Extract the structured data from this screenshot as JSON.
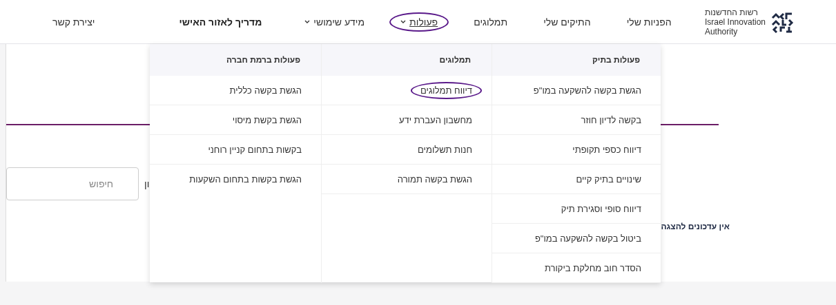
{
  "logo": {
    "lines": [
      "רשות החדשנות",
      "Israel Innovation",
      "Authority"
    ]
  },
  "nav": [
    {
      "label": "הפניות שלי",
      "kind": "link",
      "active": false,
      "circled": false
    },
    {
      "label": "התיקים שלי",
      "kind": "link",
      "active": false,
      "circled": false
    },
    {
      "label": "תמלוגים",
      "kind": "link",
      "active": false,
      "circled": false
    },
    {
      "label": "פעולות",
      "kind": "dropdown",
      "active": true,
      "circled": true
    },
    {
      "label": "מידע שימושי",
      "kind": "dropdown",
      "active": false,
      "circled": false
    },
    {
      "label": "מדריך לאזור האישי",
      "kind": "bold",
      "active": false,
      "circled": false
    },
    {
      "label": "יצירת קשר",
      "kind": "link",
      "active": false,
      "circled": false
    }
  ],
  "menu": {
    "columns": [
      {
        "heading": "פעולות בתיק",
        "items": [
          {
            "label": "הגשת בקשה להשקעה במו\"פ",
            "circled": false
          },
          {
            "label": "בקשה לדיון חוזר",
            "circled": false
          },
          {
            "label": "דיווח כספי תקופתי",
            "circled": false
          },
          {
            "label": "שינויים בתיק קיים",
            "circled": false
          },
          {
            "label": "דיווח סופי וסגירת תיק",
            "circled": false
          },
          {
            "label": "ביטול בקשה להשקעה במו\"פ",
            "circled": false
          },
          {
            "label": "הסדר חוב מחלקת ביקורת",
            "circled": false
          }
        ]
      },
      {
        "heading": "תמלוגים",
        "items": [
          {
            "label": "דיווח תמלוגים",
            "circled": true
          },
          {
            "label": "מחשבון העברת ידע",
            "circled": false
          },
          {
            "label": "חנות תשלומים",
            "circled": false
          },
          {
            "label": "הגשת בקשה תמורה",
            "circled": false
          }
        ]
      },
      {
        "heading": "פעולות ברמת חברה",
        "items": [
          {
            "label": "הגשת בקשה כללית",
            "circled": false
          },
          {
            "label": "הגשת בקשת מיסוי",
            "circled": false
          },
          {
            "label": "בקשות בתחום קניין רוחני",
            "circled": false
          },
          {
            "label": "הגשת בקשות בתחום השקעות",
            "circled": false
          }
        ]
      }
    ]
  },
  "search": {
    "label": "ון",
    "placeholder": "חיפוש"
  },
  "updates": {
    "empty_message": "אין עדכונים להצגה"
  }
}
